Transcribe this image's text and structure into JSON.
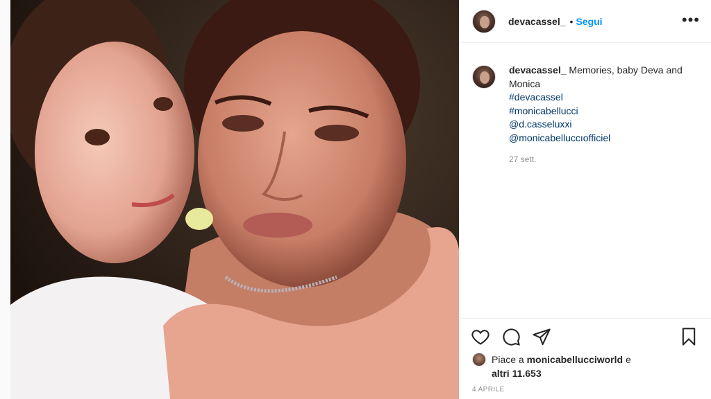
{
  "post": {
    "author": "devacassel_",
    "separator": "•",
    "follow_label": "Segui",
    "more_label": "•••",
    "caption": {
      "username": "devacassel_",
      "text": "Memories, baby Deva and Monica",
      "tags": [
        "#devacassel",
        "#monicabellucci",
        "@d.casseluxxi",
        "@monicabelluccıofficiel"
      ],
      "time": "27 sett."
    },
    "likes": {
      "prefix": "Piace a",
      "user": "monicabellucciworld",
      "middle": "e",
      "others": "altri 11.653"
    },
    "date": "4 APRILE"
  },
  "icons": {
    "like": "heart-icon",
    "comment": "comment-icon",
    "share": "share-icon",
    "save": "bookmark-icon"
  },
  "colors": {
    "accent": "#0095f6",
    "link": "#00376b",
    "muted": "#8e8e8e",
    "text": "#262626"
  }
}
